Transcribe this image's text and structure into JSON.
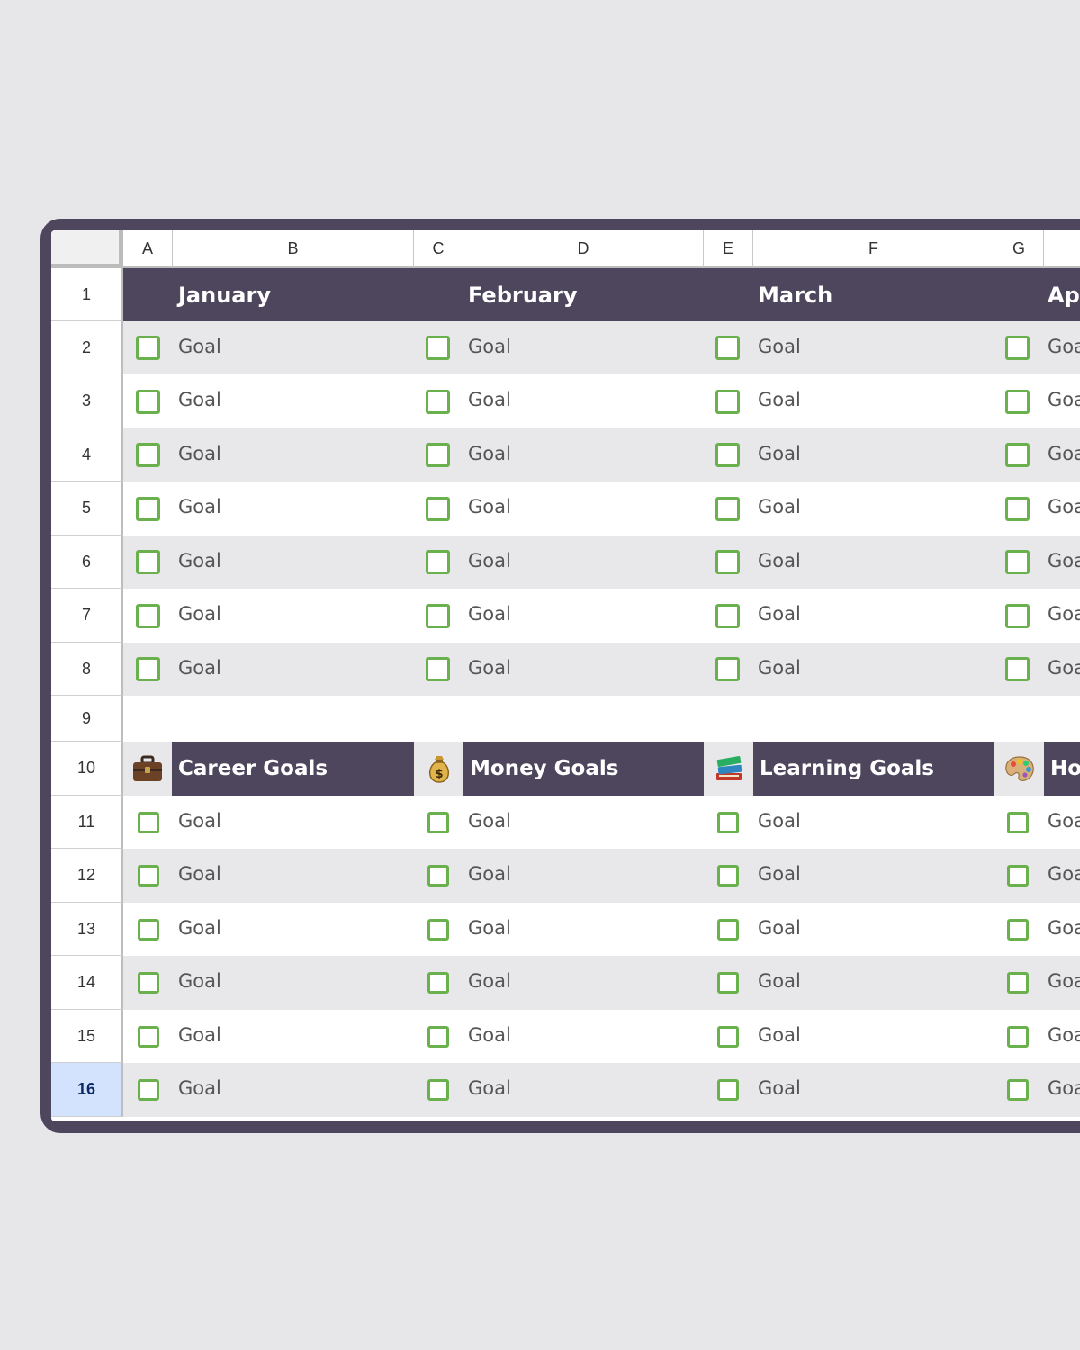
{
  "columns": [
    "A",
    "B",
    "C",
    "D",
    "E",
    "F",
    "G"
  ],
  "rows": [
    "1",
    "2",
    "3",
    "4",
    "5",
    "6",
    "7",
    "8",
    "9",
    "10",
    "11",
    "12",
    "13",
    "14",
    "15",
    "16"
  ],
  "active_row": "16",
  "months": [
    "January",
    "February",
    "March",
    "Ap"
  ],
  "categories": [
    {
      "title": "Career Goals",
      "icon": "briefcase-icon"
    },
    {
      "title": "Money Goals",
      "icon": "money-bag-icon"
    },
    {
      "title": "Learning Goals",
      "icon": "books-icon"
    },
    {
      "title": "Ho",
      "icon": "palette-icon"
    }
  ],
  "goal_label": "Goal",
  "goal_label_clipped": "Goa",
  "colors": {
    "header_bg": "#4d465d",
    "stripe": "#e8e8eb",
    "checkbox": "#6ab04c",
    "frame": "#4d465d"
  }
}
